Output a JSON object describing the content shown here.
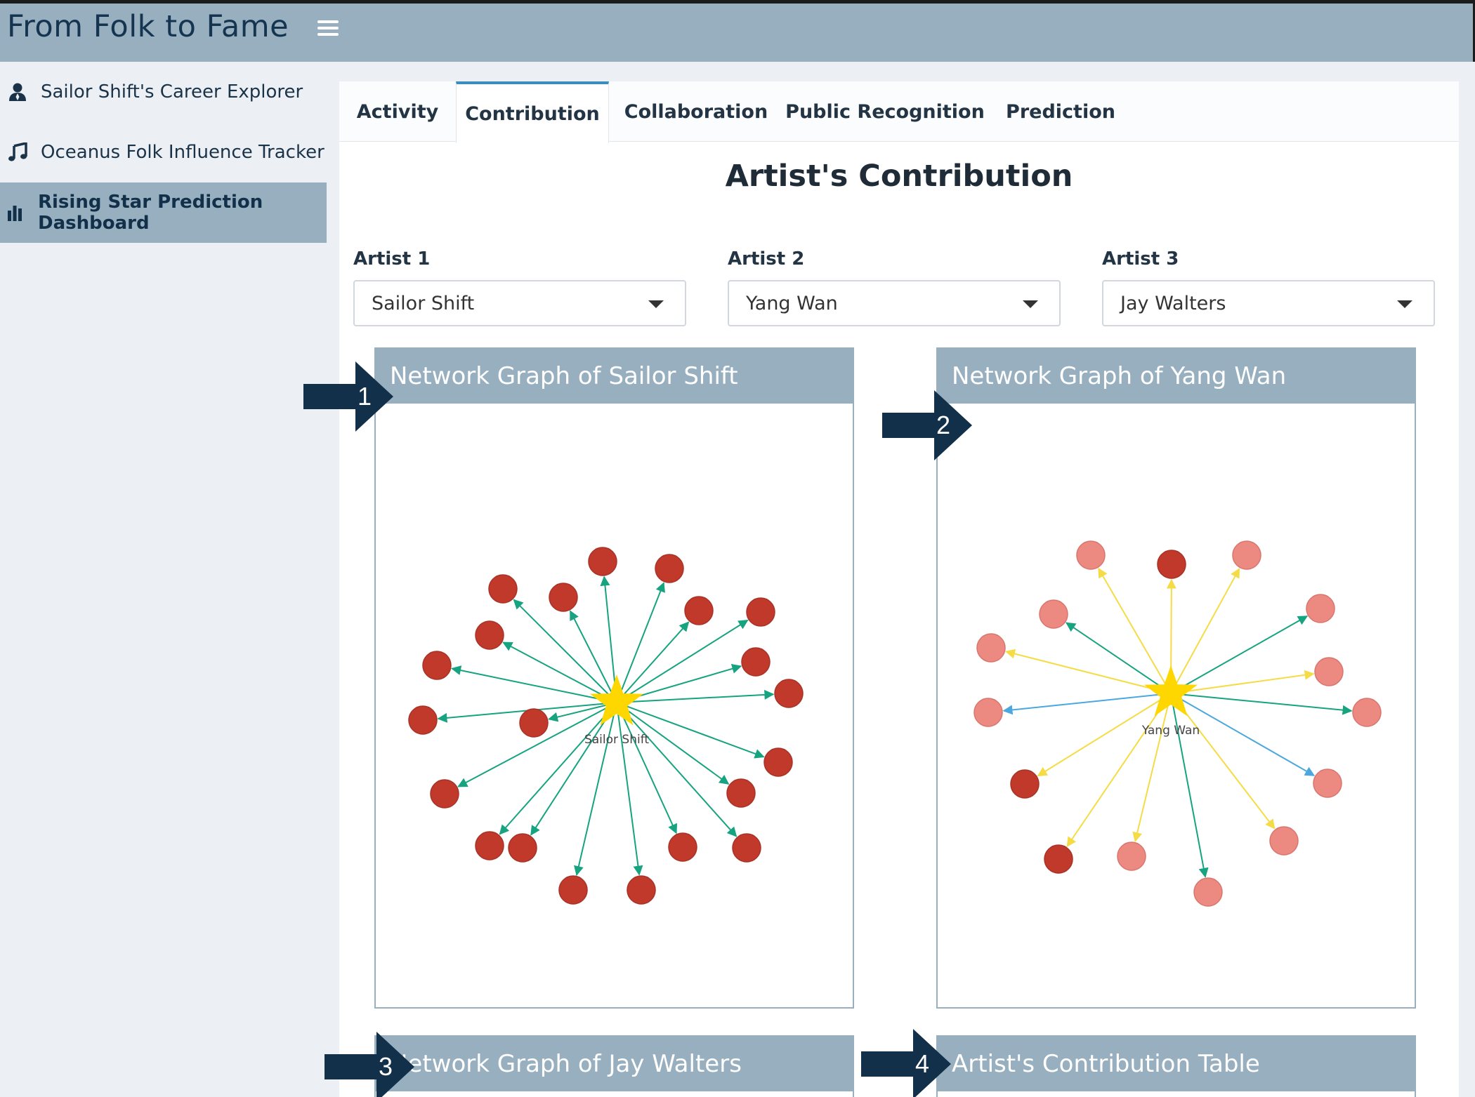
{
  "app": {
    "title": "From Folk to Fame"
  },
  "sidebar": {
    "items": [
      {
        "label": "Sailor Shift's Career Explorer",
        "icon": "user-icon"
      },
      {
        "label": "Oceanus Folk Influence Tracker",
        "icon": "music-icon"
      },
      {
        "label": "Rising Star Prediction Dashboard",
        "icon": "bar-chart-icon",
        "active": true
      }
    ]
  },
  "tabs": [
    {
      "label": "Activity"
    },
    {
      "label": "Contribution",
      "active": true
    },
    {
      "label": "Collaboration"
    },
    {
      "label": "Public Recognition"
    },
    {
      "label": "Prediction"
    }
  ],
  "content": {
    "title": "Artist's Contribution",
    "selectors": [
      {
        "label": "Artist 1",
        "value": "Sailor Shift"
      },
      {
        "label": "Artist 2",
        "value": "Yang Wan"
      },
      {
        "label": "Artist 3",
        "value": "Jay Walters"
      }
    ],
    "boxes": [
      {
        "title": "Network Graph of Sailor Shift",
        "center_label": "Sailor Shift"
      },
      {
        "title": "Network Graph of Yang Wan",
        "center_label": "Yang Wan"
      },
      {
        "title": "Network Graph of Jay Walters"
      },
      {
        "title": "Artist's Contribution Table"
      }
    ]
  },
  "annotations": [
    "1",
    "2",
    "3",
    "4"
  ],
  "colors": {
    "header": "#97afbf",
    "accent": "#3c8dbc",
    "node_dark": "#c0392b",
    "node_light": "#ec8a82",
    "star": "#ffd700",
    "edge_green": "#16a37f",
    "edge_yellow": "#f5dc46",
    "edge_blue": "#4aa8df",
    "annotation_arrow": "#12304a"
  }
}
